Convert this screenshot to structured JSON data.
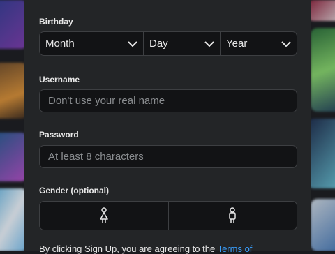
{
  "form": {
    "birthday": {
      "label": "Birthday",
      "month": "Month",
      "day": "Day",
      "year": "Year"
    },
    "username": {
      "label": "Username",
      "placeholder": "Don't use your real name"
    },
    "password": {
      "label": "Password",
      "placeholder": "At least 8 characters"
    },
    "gender": {
      "label": "Gender (optional)",
      "options": [
        "female-icon",
        "male-icon"
      ]
    },
    "terms": {
      "text": "By clicking Sign Up, you are agreeing to the ",
      "link": "Terms of"
    }
  },
  "colors": {
    "panel": "#232527",
    "input_bg": "#121315",
    "border": "#3d3f42",
    "text": "#e8e8e8",
    "placeholder": "#8a8d90",
    "link": "#3aa0ff"
  }
}
